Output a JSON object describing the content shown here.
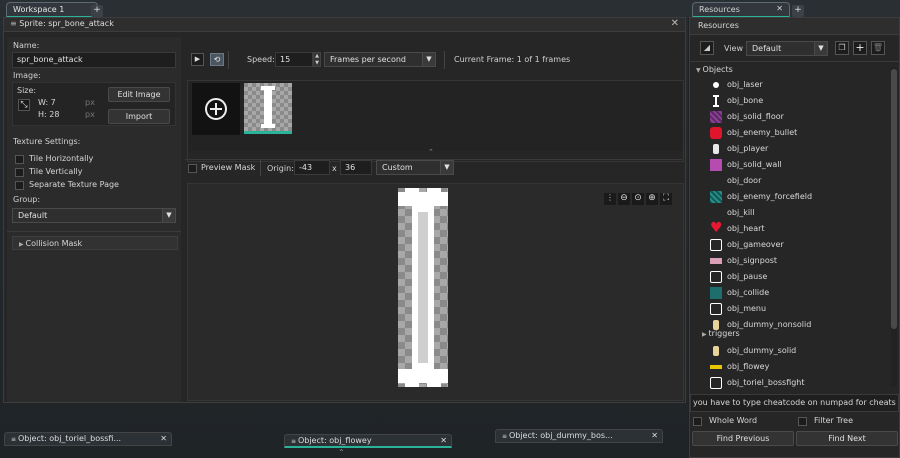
{
  "workspace": {
    "tab_label": "Workspace 1"
  },
  "sprite_editor": {
    "title": "Sprite: spr_bone_attack",
    "name_label": "Name:",
    "name_value": "spr_bone_attack",
    "image_label": "Image:",
    "size_label": "Size:",
    "width_label": "W: 7",
    "height_label": "H: 28",
    "px": "px",
    "edit_image": "Edit Image",
    "import": "Import",
    "texture_settings": "Texture Settings:",
    "tile_h": "Tile Horizontally",
    "tile_v": "Tile Vertically",
    "separate_page": "Separate Texture Page",
    "group_label": "Group:",
    "group_value": "Default",
    "collision_mask": "Collision Mask",
    "speed_label": "Speed:",
    "speed_value": "15",
    "speed_unit": "Frames per second",
    "current_frame": "Current Frame: 1 of 1 frames",
    "preview_mask": "Preview Mask",
    "origin_label": "Origin:",
    "origin_x": "-43",
    "x_sep": "x",
    "origin_y": "36",
    "origin_mode": "Custom"
  },
  "bottom_tabs": [
    {
      "label": "Object: obj_toriel_bossfi..."
    },
    {
      "label": "Object: obj_flowey"
    },
    {
      "label": "Object: obj_dummy_bos..."
    }
  ],
  "resources": {
    "tab_label": "Resources",
    "header": "Resources",
    "view_label": "View",
    "view_value": "Default",
    "objects_folder": "Objects",
    "items": [
      {
        "name": "obj_laser",
        "icon": "dot-icon"
      },
      {
        "name": "obj_bone",
        "icon": "bone-icon"
      },
      {
        "name": "obj_solid_floor",
        "icon": "purple-pattern-icon"
      },
      {
        "name": "obj_enemy_bullet",
        "icon": "red-square-icon"
      },
      {
        "name": "obj_player",
        "icon": "player-icon"
      },
      {
        "name": "obj_solid_wall",
        "icon": "magenta-square-icon"
      },
      {
        "name": "obj_door",
        "icon": "none"
      },
      {
        "name": "obj_enemy_forcefield",
        "icon": "teal-pattern-icon"
      },
      {
        "name": "obj_kill",
        "icon": "none"
      },
      {
        "name": "obj_heart",
        "icon": "heart-icon"
      },
      {
        "name": "obj_gameover",
        "icon": "frame-icon"
      },
      {
        "name": "obj_signpost",
        "icon": "sign-icon"
      },
      {
        "name": "obj_pause",
        "icon": "frame-icon"
      },
      {
        "name": "obj_collide",
        "icon": "teal-square-icon"
      },
      {
        "name": "obj_menu",
        "icon": "frame-icon"
      },
      {
        "name": "obj_dummy_nonsolid",
        "icon": "dummy-icon"
      }
    ],
    "triggers_folder": "triggers",
    "items2": [
      {
        "name": "obj_dummy_solid",
        "icon": "dummy-icon"
      },
      {
        "name": "obj_flowey",
        "icon": "flowey-icon"
      },
      {
        "name": "obj_toriel_bossfight",
        "icon": "frame-icon"
      }
    ],
    "search_value": "you have to type cheatcode on numpad for cheats ;)",
    "whole_word": "Whole Word",
    "filter_tree": "Filter Tree",
    "find_previous": "Find Previous",
    "find_next": "Find Next"
  },
  "colors": {
    "accent": "#2bb39a"
  }
}
